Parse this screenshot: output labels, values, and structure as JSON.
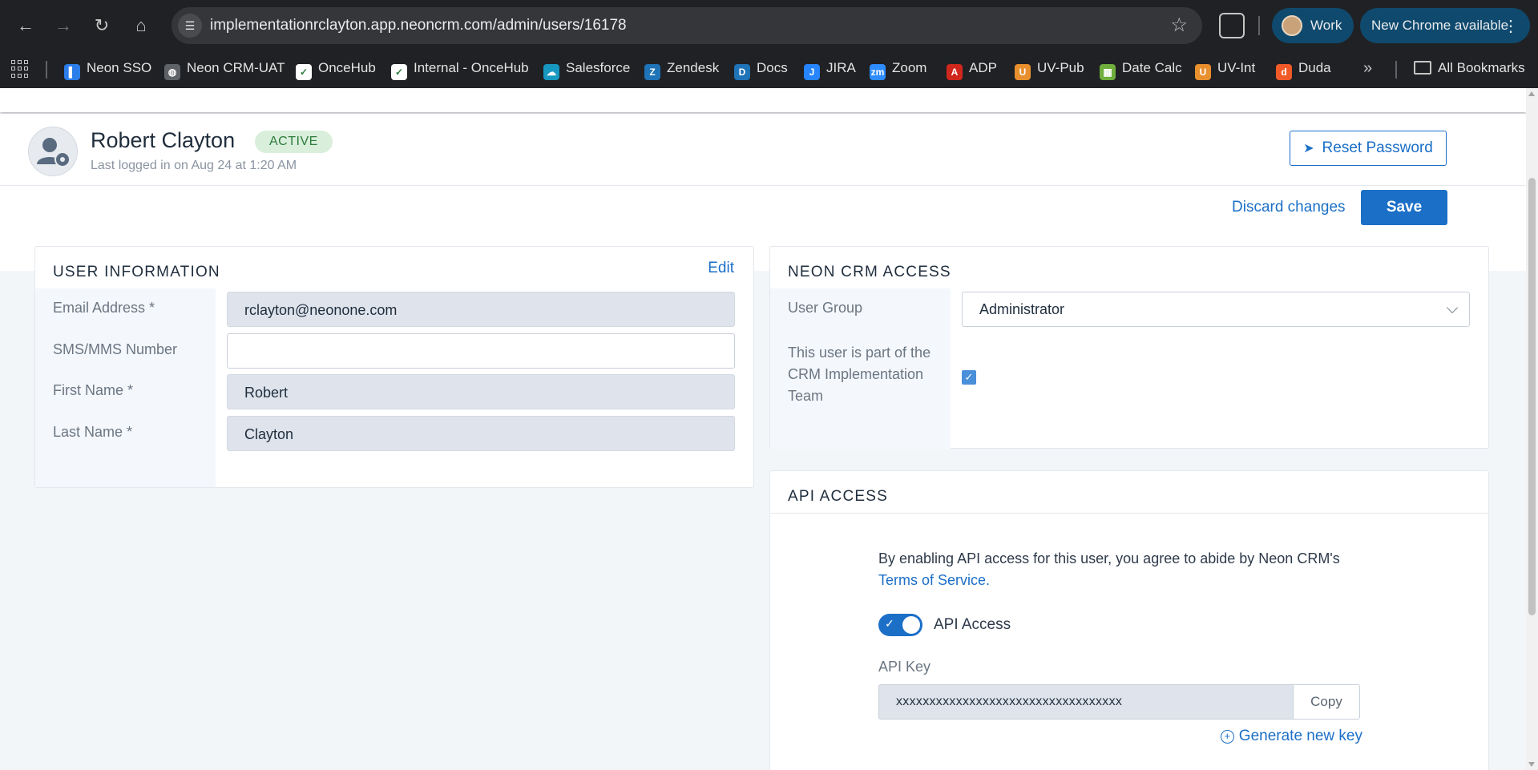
{
  "browser": {
    "url": "implementationrclayton.app.neoncrm.com/admin/users/16178",
    "profile_label": "Work",
    "update_label": "New Chrome available",
    "bookmarks": [
      {
        "label": "Neon SSO",
        "color": "#2b7de9",
        "glyph": "▌"
      },
      {
        "label": "Neon CRM-UAT",
        "color": "#5f6368",
        "glyph": "◍"
      },
      {
        "label": "OnceHub",
        "color": "#ffffff",
        "glyph": "✓"
      },
      {
        "label": "Internal - OnceHub",
        "color": "#ffffff",
        "glyph": "✓"
      },
      {
        "label": "Salesforce",
        "color": "#1798c1",
        "glyph": "☁"
      },
      {
        "label": "Zendesk",
        "color": "#1f73b7",
        "glyph": "Z"
      },
      {
        "label": "Docs",
        "color": "#1f73b7",
        "glyph": "D"
      },
      {
        "label": "JIRA",
        "color": "#2684ff",
        "glyph": "J"
      },
      {
        "label": "Zoom",
        "color": "#2d8cff",
        "glyph": "zm"
      },
      {
        "label": "ADP",
        "color": "#d0271d",
        "glyph": "A"
      },
      {
        "label": "UV-Pub",
        "color": "#e8902e",
        "glyph": "U"
      },
      {
        "label": "Date Calc",
        "color": "#6fae3d",
        "glyph": "▦"
      },
      {
        "label": "UV-Int",
        "color": "#e8902e",
        "glyph": "U"
      },
      {
        "label": "Duda",
        "color": "#f05a28",
        "glyph": "d"
      }
    ],
    "all_bookmarks_label": "All Bookmarks"
  },
  "user": {
    "name": "Robert Clayton",
    "status": "ACTIVE",
    "last_login": "Last logged in on Aug 24 at 1:20 AM",
    "reset_password_label": "Reset Password"
  },
  "actions": {
    "discard_label": "Discard changes",
    "save_label": "Save"
  },
  "user_information": {
    "title": "USER INFORMATION",
    "edit_label": "Edit",
    "fields": {
      "email_label": "Email Address *",
      "email_value": "rclayton@neonone.com",
      "sms_label": "SMS/MMS Number",
      "sms_value": "",
      "first_name_label": "First Name *",
      "first_name_value": "Robert",
      "last_name_label": "Last Name *",
      "last_name_value": "Clayton"
    }
  },
  "crm_access": {
    "title": "NEON CRM ACCESS",
    "user_group_label": "User Group",
    "user_group_value": "Administrator",
    "impl_team_label": "This user is part of the CRM Implementation Team",
    "impl_team_checked": true
  },
  "api_access": {
    "title": "API ACCESS",
    "agreement_text": "By enabling API access for this user, you agree to abide by Neon CRM's",
    "tos_link": "Terms of Service.",
    "toggle_label": "API Access",
    "toggle_on": true,
    "key_label": "API Key",
    "key_value": "xxxxxxxxxxxxxxxxxxxxxxxxxxxxxxxxxx",
    "copy_label": "Copy",
    "generate_label": "Generate new key"
  }
}
